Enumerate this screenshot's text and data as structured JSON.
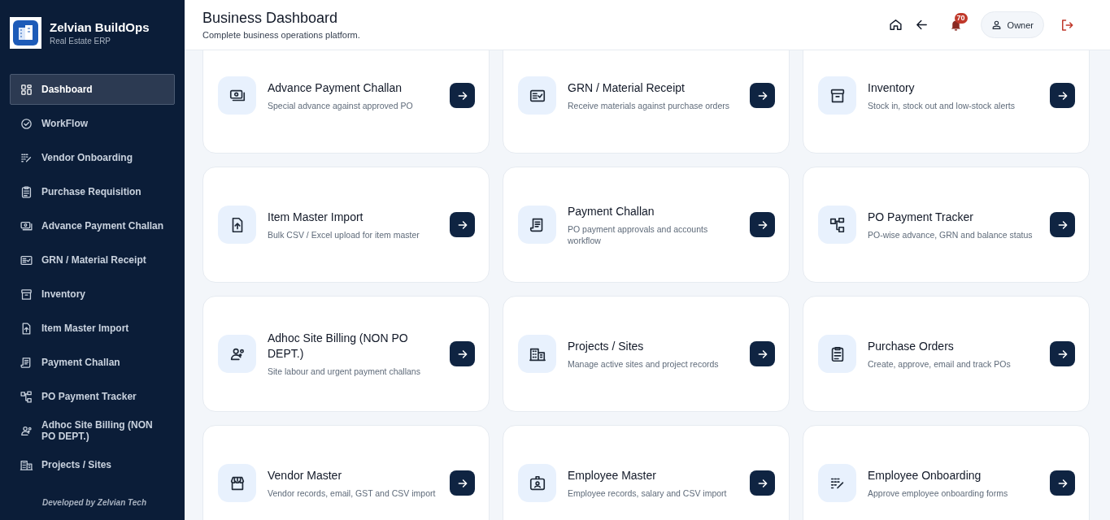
{
  "brand": {
    "name": "Zelvian BuildOps",
    "subtitle": "Real Estate ERP"
  },
  "sidebar": {
    "items": [
      {
        "label": "Dashboard",
        "selected": true
      },
      {
        "label": "WorkFlow",
        "selected": false
      },
      {
        "label": "Vendor Onboarding",
        "selected": false
      },
      {
        "label": "Purchase Requisition",
        "selected": false
      },
      {
        "label": "Advance Payment Challan",
        "selected": false
      },
      {
        "label": "GRN / Material Receipt",
        "selected": false
      },
      {
        "label": "Inventory",
        "selected": false
      },
      {
        "label": "Item Master Import",
        "selected": false
      },
      {
        "label": "Payment Challan",
        "selected": false
      },
      {
        "label": "PO Payment Tracker",
        "selected": false
      },
      {
        "label": "Adhoc Site Billing (NON PO DEPT.)",
        "selected": false
      },
      {
        "label": "Projects / Sites",
        "selected": false
      }
    ],
    "footer": "Developed by Zelvian Tech"
  },
  "header": {
    "title": "Business Dashboard",
    "subtitle": "Complete business operations platform.",
    "notification_count": "70",
    "user": "Owner"
  },
  "cards": [
    {
      "title": "Advance Payment Challan",
      "description": "Special advance against approved PO"
    },
    {
      "title": "GRN / Material Receipt",
      "description": "Receive materials against purchase orders"
    },
    {
      "title": "Inventory",
      "description": "Stock in, stock out and low-stock alerts"
    },
    {
      "title": "Item Master Import",
      "description": "Bulk CSV / Excel upload for item master"
    },
    {
      "title": "Payment Challan",
      "description": "PO payment approvals and accounts workflow"
    },
    {
      "title": "PO Payment Tracker",
      "description": "PO-wise advance, GRN and balance status"
    },
    {
      "title": "Adhoc Site Billing (NON PO DEPT.)",
      "description": "Site labour and urgent payment challans"
    },
    {
      "title": "Projects / Sites",
      "description": "Manage active sites and project records"
    },
    {
      "title": "Purchase Orders",
      "description": "Create, approve, email and track POs"
    },
    {
      "title": "Vendor Master",
      "description": "Vendor records, email, GST and CSV import"
    },
    {
      "title": "Employee Master",
      "description": "Employee records, salary and CSV import"
    },
    {
      "title": "Employee Onboarding",
      "description": "Approve employee onboarding forms"
    }
  ]
}
